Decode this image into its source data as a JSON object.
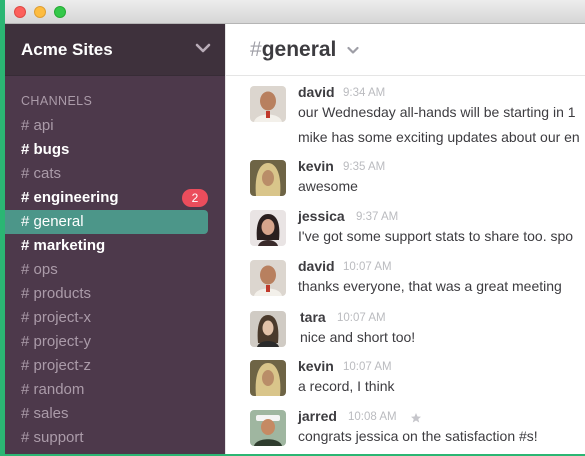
{
  "window": {
    "accent": "#2bb673"
  },
  "sidebar": {
    "team_name": "Acme Sites",
    "channels_header": "CHANNELS",
    "channels": [
      {
        "label": "# api",
        "state": "normal"
      },
      {
        "label": "# bugs",
        "state": "unread"
      },
      {
        "label": "# cats",
        "state": "normal"
      },
      {
        "label": "# engineering",
        "state": "unread",
        "badge": "2"
      },
      {
        "label": "# general",
        "state": "active"
      },
      {
        "label": "# marketing",
        "state": "unread"
      },
      {
        "label": "# ops",
        "state": "normal"
      },
      {
        "label": "# products",
        "state": "normal"
      },
      {
        "label": "# project-x",
        "state": "normal"
      },
      {
        "label": "# project-y",
        "state": "normal"
      },
      {
        "label": "# project-z",
        "state": "normal"
      },
      {
        "label": "# random",
        "state": "normal"
      },
      {
        "label": "# sales",
        "state": "normal"
      },
      {
        "label": "# support",
        "state": "normal"
      }
    ],
    "colors": {
      "background": "#4d394b",
      "header": "#3e313c",
      "active": "#4c9689",
      "badge": "#eb4d5c"
    }
  },
  "header": {
    "hash": "#",
    "channel_name": "general",
    "dropdown_icon": "chevron-down-icon"
  },
  "messages": [
    {
      "author": "david",
      "time": "9:34 AM",
      "lines": [
        "our Wednesday all-hands will be starting in 1",
        "mike has some exciting updates about our en"
      ]
    },
    {
      "author": "kevin",
      "time": "9:35 AM",
      "lines": [
        "awesome"
      ]
    },
    {
      "author": "jessica",
      "time": "9:37 AM",
      "lines": [
        "I've got some support stats to share too. spo"
      ]
    },
    {
      "author": "david",
      "time": "10:07 AM",
      "lines": [
        "thanks everyone, that was a great meeting"
      ]
    },
    {
      "author": "tara",
      "time": "10:07 AM",
      "lines": [
        "nice and short too!"
      ]
    },
    {
      "author": "kevin",
      "time": "10:07 AM",
      "lines": [
        "a record, I think"
      ]
    },
    {
      "author": "jarred",
      "time": "10:08 AM",
      "lines": [
        "congrats jessica on the satisfaction #s!"
      ],
      "starred": true,
      "star_icon": "star-icon"
    }
  ]
}
